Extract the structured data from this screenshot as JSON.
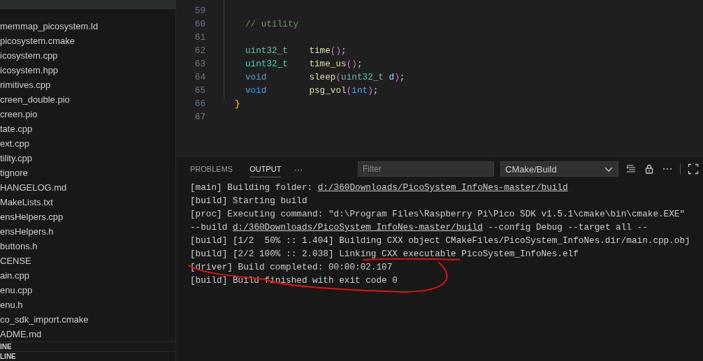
{
  "sidebar": {
    "files": [
      {
        "name": "memmap_picosystem.ld"
      },
      {
        "name": "picosystem.cmake"
      },
      {
        "name": "icosystem.cpp"
      },
      {
        "name": "icosystem.hpp"
      },
      {
        "name": "rimitives.cpp"
      },
      {
        "name": "creen_double.pio"
      },
      {
        "name": "creen.pio"
      },
      {
        "name": "tate.cpp"
      },
      {
        "name": "ext.cpp"
      },
      {
        "name": "tility.cpp"
      },
      {
        "name": "tignore"
      },
      {
        "name": "HANGELOG.md"
      },
      {
        "name": "MakeLists.txt"
      },
      {
        "name": "ensHelpers.cpp"
      },
      {
        "name": "ensHelpers.h"
      },
      {
        "name": "buttons.h"
      },
      {
        "name": "CENSE"
      },
      {
        "name": "ain.cpp"
      },
      {
        "name": "enu.cpp"
      },
      {
        "name": "enu.h"
      },
      {
        "name": "co_sdk_import.cmake"
      },
      {
        "name": "ADME.md"
      }
    ],
    "sections": [
      "INE",
      "LINE"
    ]
  },
  "editor": {
    "lines": [
      {
        "number": "59"
      },
      {
        "number": "60",
        "tokens": [
          {
            "kind": "comment",
            "text": "// utility"
          }
        ]
      },
      {
        "number": "61"
      },
      {
        "number": "62",
        "tokens": [
          {
            "kind": "type",
            "text": "uint32_t"
          },
          {
            "kind": "func",
            "text": "    time"
          },
          {
            "kind": "bracket",
            "text": "()"
          },
          {
            "kind": "plain",
            "text": ";"
          }
        ]
      },
      {
        "number": "63",
        "tokens": [
          {
            "kind": "type",
            "text": "uint32_t"
          },
          {
            "kind": "func",
            "text": "    time_us"
          },
          {
            "kind": "bracket",
            "text": "()"
          },
          {
            "kind": "plain",
            "text": ";"
          }
        ]
      },
      {
        "number": "64",
        "tokens": [
          {
            "kind": "keyword",
            "text": "void"
          },
          {
            "kind": "func",
            "text": "        sleep"
          },
          {
            "kind": "bracket",
            "text": "("
          },
          {
            "kind": "type",
            "text": "uint32_t"
          },
          {
            "kind": "param",
            "text": " d"
          },
          {
            "kind": "bracket",
            "text": ")"
          },
          {
            "kind": "plain",
            "text": ";"
          }
        ]
      },
      {
        "number": "65",
        "tokens": [
          {
            "kind": "keyword",
            "text": "void"
          },
          {
            "kind": "func",
            "text": "        psg_vol"
          },
          {
            "kind": "bracket",
            "text": "("
          },
          {
            "kind": "keyword",
            "text": "int"
          },
          {
            "kind": "bracket",
            "text": ")"
          },
          {
            "kind": "plain",
            "text": ";"
          }
        ]
      },
      {
        "number": "66",
        "tokens": [
          {
            "kind": "brace",
            "text": "}"
          }
        ]
      },
      {
        "number": "67"
      }
    ]
  },
  "panel": {
    "tabs": [
      {
        "label": "PROBLEMS",
        "selected": false
      },
      {
        "label": "OUTPUT",
        "selected": true
      }
    ],
    "more": "···",
    "filter": {
      "placeholder": "Filter"
    },
    "channel": "CMake/Build",
    "output": [
      [
        {
          "text": "[main] Building folder: ",
          "link": false
        },
        {
          "text": "d:/360Downloads/PicoSystem_InfoNes-master/build",
          "link": true
        }
      ],
      [
        {
          "text": "[build] Starting build",
          "link": false
        }
      ],
      [
        {
          "text": "[proc] Executing command: \"d:\\Program Files\\Raspberry Pi\\Pico SDK v1.5.1\\cmake\\bin\\cmake.EXE\"",
          "link": false
        }
      ],
      [
        {
          "text": "--build ",
          "link": false
        },
        {
          "text": "d:/360Downloads/PicoSystem_InfoNes-master/build",
          "link": true
        },
        {
          "text": " --config Debug --target all --",
          "link": false
        }
      ],
      [
        {
          "text": "[build] [1/2  50% :: 1.404] Building CXX object CMakeFiles/PicoSystem_InfoNes.dir/main.cpp.obj",
          "link": false
        }
      ],
      [
        {
          "text": "[build] [2/2 100% :: 2.038] Linking CXX executable PicoSystem_InfoNes.elf",
          "link": false
        }
      ],
      [
        {
          "text": "[driver] Build completed: 00:00:02.107",
          "link": false
        }
      ],
      [
        {
          "text": "[build] Build finished with exit code 0",
          "link": false
        }
      ]
    ]
  }
}
